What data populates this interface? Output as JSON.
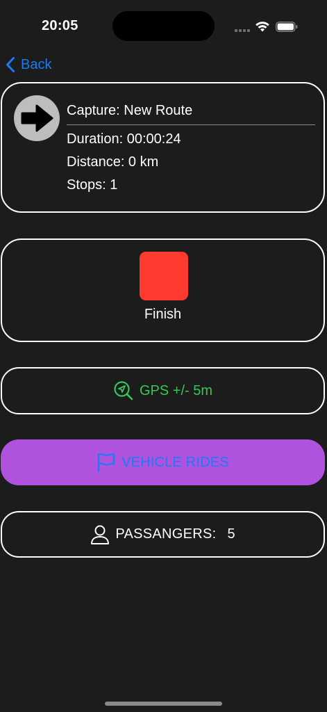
{
  "status_bar": {
    "time": "20:05"
  },
  "nav": {
    "back_label": "Back"
  },
  "capture": {
    "title": "Capture: New Route",
    "duration": "Duration: 00:00:24",
    "distance": "Distance: 0 km",
    "stops": "Stops: 1"
  },
  "finish": {
    "label": "Finish"
  },
  "gps": {
    "label": "GPS +/- 5m"
  },
  "ride": {
    "label": "VEHICLE RIDES"
  },
  "passengers": {
    "label": "PASSANGERS:",
    "count": "5"
  },
  "icons": {
    "back": "chevron-left-icon",
    "direction": "arrow-right-icon",
    "stop": "stop-square-icon",
    "gps": "location-search-icon",
    "ride": "flag-icon",
    "passenger": "person-icon"
  },
  "colors": {
    "background": "#1c1c1c",
    "accent_blue": "#1a7cf5",
    "gps_green": "#34c759",
    "stop_red": "#ff3b30",
    "ride_purple": "#af52de"
  }
}
